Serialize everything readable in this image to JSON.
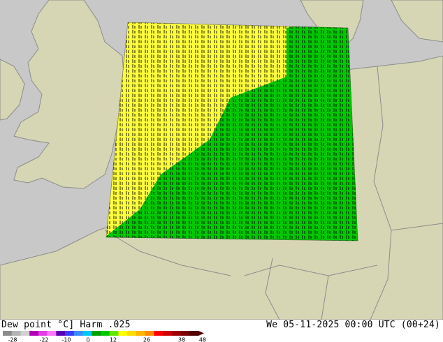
{
  "legend": {
    "title_left": "Dew point °C] Harm .025",
    "title_right": "We 05-11-2025 00:00 UTC (00+24)",
    "scale_ticks": [
      "-28",
      "-22",
      "-10",
      "0",
      "12",
      "26",
      "38",
      "48"
    ],
    "scale_colors": [
      "#8c8c8c",
      "#b4b4b4",
      "#d2d2d2",
      "#b400b4",
      "#e63ce6",
      "#ff78ff",
      "#5a00b4",
      "#3c3cff",
      "#3c8cff",
      "#00c8ff",
      "#00a000",
      "#00c800",
      "#64e600",
      "#ffff00",
      "#ffdc00",
      "#ffb400",
      "#ff8c00",
      "#ff0000",
      "#d20000",
      "#a00000",
      "#780000",
      "#500000"
    ]
  },
  "map": {
    "colors": {
      "sea": "#c8c8c8",
      "land": "#d6d6b4",
      "border": "#8c8c8c",
      "field_yellow": "#ffff3c",
      "field_green": "#00c800",
      "label": "#000000"
    },
    "field_value_yellow": "16",
    "field_value_green": "11"
  }
}
